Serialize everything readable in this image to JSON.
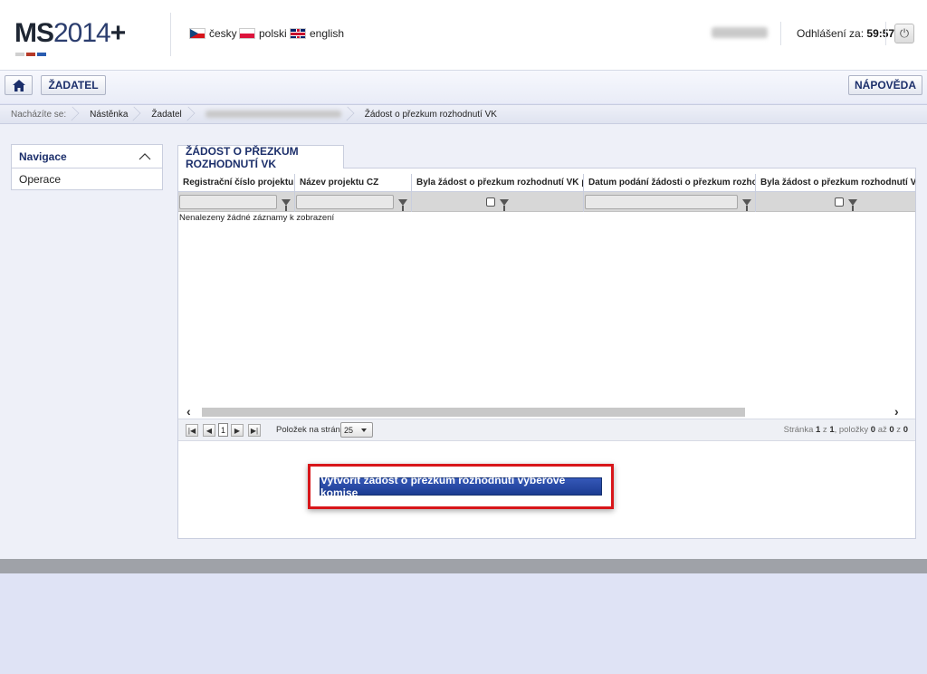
{
  "header": {
    "logo": {
      "ms": "MS",
      "year": "2014",
      "plus": "+"
    },
    "logo_colors": [
      "#d0d0d0",
      "#b63a28",
      "#2a5cb0"
    ],
    "languages": [
      {
        "label": "česky",
        "icon": "czech-flag-icon"
      },
      {
        "label": "polski",
        "icon": "polish-flag-icon"
      },
      {
        "label": "english",
        "icon": "uk-flag-icon"
      }
    ],
    "logout_label": "Odhlášení za:",
    "logout_time": "59:57",
    "power_icon": "power-icon"
  },
  "toolbar": {
    "home_icon": "home-icon",
    "zadatel_label": "ŽADATEL",
    "help_label": "NÁPOVĚDA"
  },
  "breadcrumb": {
    "intro": "Nacházíte se:",
    "items": [
      "Nástěnka",
      "Žadatel",
      "Žádost o přezkum rozhodnutí VK"
    ]
  },
  "sidebar": {
    "title": "Navigace",
    "items": [
      "Operace"
    ]
  },
  "main": {
    "tab_label": "ŽÁDOST O PŘEZKUM ROZHODNUTÍ VK",
    "grid": {
      "columns": [
        "Registrační číslo projektu",
        "Název projektu CZ",
        "Byla žádost o přezkum rozhodnutí VK podána?",
        "Datum podání žádosti o přezkum rozhodnutí VK",
        "Byla žádost o přezkum rozhodnutí VK vypořádána?"
      ],
      "empty_message": "Nenalezeny žádné záznamy k zobrazení"
    },
    "pager": {
      "current_page": "1",
      "per_page_label": "Položek na stránku",
      "per_page_value": "25",
      "info_prefix": "Stránka ",
      "page": "1",
      "of": " z ",
      "pages": "1",
      "items_prefix": ", položky ",
      "from": "0",
      "to_label": " až ",
      "to": "0",
      "total_label": " z ",
      "total": "0"
    },
    "action_button": "Vytvořit žádost o přezkum rozhodnutí výběrové komise",
    "highlight_color": "#d8161a"
  }
}
